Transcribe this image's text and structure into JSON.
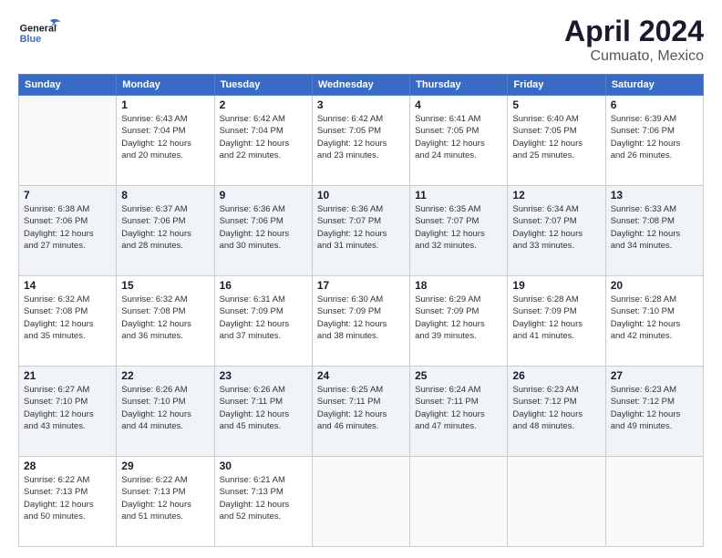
{
  "header": {
    "title": "April 2024",
    "subtitle": "Cumuato, Mexico",
    "logo_line1": "General",
    "logo_line2": "Blue"
  },
  "weekdays": [
    "Sunday",
    "Monday",
    "Tuesday",
    "Wednesday",
    "Thursday",
    "Friday",
    "Saturday"
  ],
  "weeks": [
    [
      {
        "day": "",
        "info": ""
      },
      {
        "day": "1",
        "info": "Sunrise: 6:43 AM\nSunset: 7:04 PM\nDaylight: 12 hours\nand 20 minutes."
      },
      {
        "day": "2",
        "info": "Sunrise: 6:42 AM\nSunset: 7:04 PM\nDaylight: 12 hours\nand 22 minutes."
      },
      {
        "day": "3",
        "info": "Sunrise: 6:42 AM\nSunset: 7:05 PM\nDaylight: 12 hours\nand 23 minutes."
      },
      {
        "day": "4",
        "info": "Sunrise: 6:41 AM\nSunset: 7:05 PM\nDaylight: 12 hours\nand 24 minutes."
      },
      {
        "day": "5",
        "info": "Sunrise: 6:40 AM\nSunset: 7:05 PM\nDaylight: 12 hours\nand 25 minutes."
      },
      {
        "day": "6",
        "info": "Sunrise: 6:39 AM\nSunset: 7:06 PM\nDaylight: 12 hours\nand 26 minutes."
      }
    ],
    [
      {
        "day": "7",
        "info": "Sunrise: 6:38 AM\nSunset: 7:06 PM\nDaylight: 12 hours\nand 27 minutes."
      },
      {
        "day": "8",
        "info": "Sunrise: 6:37 AM\nSunset: 7:06 PM\nDaylight: 12 hours\nand 28 minutes."
      },
      {
        "day": "9",
        "info": "Sunrise: 6:36 AM\nSunset: 7:06 PM\nDaylight: 12 hours\nand 30 minutes."
      },
      {
        "day": "10",
        "info": "Sunrise: 6:36 AM\nSunset: 7:07 PM\nDaylight: 12 hours\nand 31 minutes."
      },
      {
        "day": "11",
        "info": "Sunrise: 6:35 AM\nSunset: 7:07 PM\nDaylight: 12 hours\nand 32 minutes."
      },
      {
        "day": "12",
        "info": "Sunrise: 6:34 AM\nSunset: 7:07 PM\nDaylight: 12 hours\nand 33 minutes."
      },
      {
        "day": "13",
        "info": "Sunrise: 6:33 AM\nSunset: 7:08 PM\nDaylight: 12 hours\nand 34 minutes."
      }
    ],
    [
      {
        "day": "14",
        "info": "Sunrise: 6:32 AM\nSunset: 7:08 PM\nDaylight: 12 hours\nand 35 minutes."
      },
      {
        "day": "15",
        "info": "Sunrise: 6:32 AM\nSunset: 7:08 PM\nDaylight: 12 hours\nand 36 minutes."
      },
      {
        "day": "16",
        "info": "Sunrise: 6:31 AM\nSunset: 7:09 PM\nDaylight: 12 hours\nand 37 minutes."
      },
      {
        "day": "17",
        "info": "Sunrise: 6:30 AM\nSunset: 7:09 PM\nDaylight: 12 hours\nand 38 minutes."
      },
      {
        "day": "18",
        "info": "Sunrise: 6:29 AM\nSunset: 7:09 PM\nDaylight: 12 hours\nand 39 minutes."
      },
      {
        "day": "19",
        "info": "Sunrise: 6:28 AM\nSunset: 7:09 PM\nDaylight: 12 hours\nand 41 minutes."
      },
      {
        "day": "20",
        "info": "Sunrise: 6:28 AM\nSunset: 7:10 PM\nDaylight: 12 hours\nand 42 minutes."
      }
    ],
    [
      {
        "day": "21",
        "info": "Sunrise: 6:27 AM\nSunset: 7:10 PM\nDaylight: 12 hours\nand 43 minutes."
      },
      {
        "day": "22",
        "info": "Sunrise: 6:26 AM\nSunset: 7:10 PM\nDaylight: 12 hours\nand 44 minutes."
      },
      {
        "day": "23",
        "info": "Sunrise: 6:26 AM\nSunset: 7:11 PM\nDaylight: 12 hours\nand 45 minutes."
      },
      {
        "day": "24",
        "info": "Sunrise: 6:25 AM\nSunset: 7:11 PM\nDaylight: 12 hours\nand 46 minutes."
      },
      {
        "day": "25",
        "info": "Sunrise: 6:24 AM\nSunset: 7:11 PM\nDaylight: 12 hours\nand 47 minutes."
      },
      {
        "day": "26",
        "info": "Sunrise: 6:23 AM\nSunset: 7:12 PM\nDaylight: 12 hours\nand 48 minutes."
      },
      {
        "day": "27",
        "info": "Sunrise: 6:23 AM\nSunset: 7:12 PM\nDaylight: 12 hours\nand 49 minutes."
      }
    ],
    [
      {
        "day": "28",
        "info": "Sunrise: 6:22 AM\nSunset: 7:13 PM\nDaylight: 12 hours\nand 50 minutes."
      },
      {
        "day": "29",
        "info": "Sunrise: 6:22 AM\nSunset: 7:13 PM\nDaylight: 12 hours\nand 51 minutes."
      },
      {
        "day": "30",
        "info": "Sunrise: 6:21 AM\nSunset: 7:13 PM\nDaylight: 12 hours\nand 52 minutes."
      },
      {
        "day": "",
        "info": ""
      },
      {
        "day": "",
        "info": ""
      },
      {
        "day": "",
        "info": ""
      },
      {
        "day": "",
        "info": ""
      }
    ]
  ],
  "row_styles": [
    "white",
    "shaded",
    "white",
    "shaded",
    "white"
  ]
}
